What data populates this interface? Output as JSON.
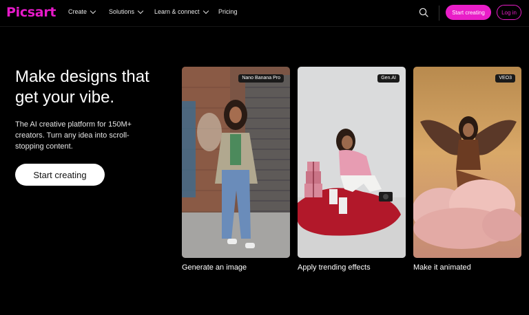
{
  "nav": {
    "logo": "Picsart",
    "items": [
      {
        "label": "Create"
      },
      {
        "label": "Solutions"
      },
      {
        "label": "Learn & connect"
      },
      {
        "label": "Pricing"
      }
    ],
    "start_button": "Start creating",
    "login_button": "Log in"
  },
  "hero": {
    "title": "Make designs that get your vibe.",
    "subtitle": "The AI creative platform for 150M+ creators. Turn any idea into scroll-stopping content.",
    "cta": "Start creating"
  },
  "cards": [
    {
      "badge": "Nano Banana Pro",
      "caption": "Generate an image"
    },
    {
      "badge": "Gen.AI",
      "caption": "Apply trending effects"
    },
    {
      "badge": "VEO3",
      "caption": "Make it animated"
    }
  ],
  "colors": {
    "brand": "#e91ec8",
    "background": "#000000"
  }
}
